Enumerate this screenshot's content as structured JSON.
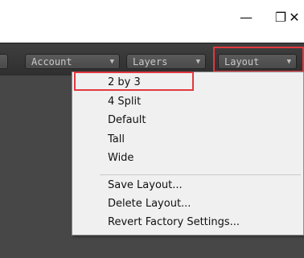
{
  "window": {
    "minimize_glyph": "—",
    "maximize_glyph": "❐",
    "close_glyph": "✕"
  },
  "toolbar": {
    "buttons": [
      {
        "label": "Account",
        "icon": "chevron-down-icon"
      },
      {
        "label": "Layers",
        "icon": "chevron-down-icon"
      },
      {
        "label": "Layout",
        "icon": "chevron-down-icon"
      }
    ]
  },
  "layout_menu": {
    "items": [
      {
        "label": "2 by 3",
        "highlighted": true
      },
      {
        "label": "4 Split"
      },
      {
        "label": "Default"
      },
      {
        "label": "Tall"
      },
      {
        "label": "Wide"
      },
      {
        "label": "Save Layout..."
      },
      {
        "label": "Delete Layout..."
      },
      {
        "label": "Revert Factory Settings..."
      }
    ]
  },
  "colors": {
    "highlight_border": "#e2383f",
    "menu_background": "#f0f0f0",
    "toolbar_background": "#383838"
  }
}
